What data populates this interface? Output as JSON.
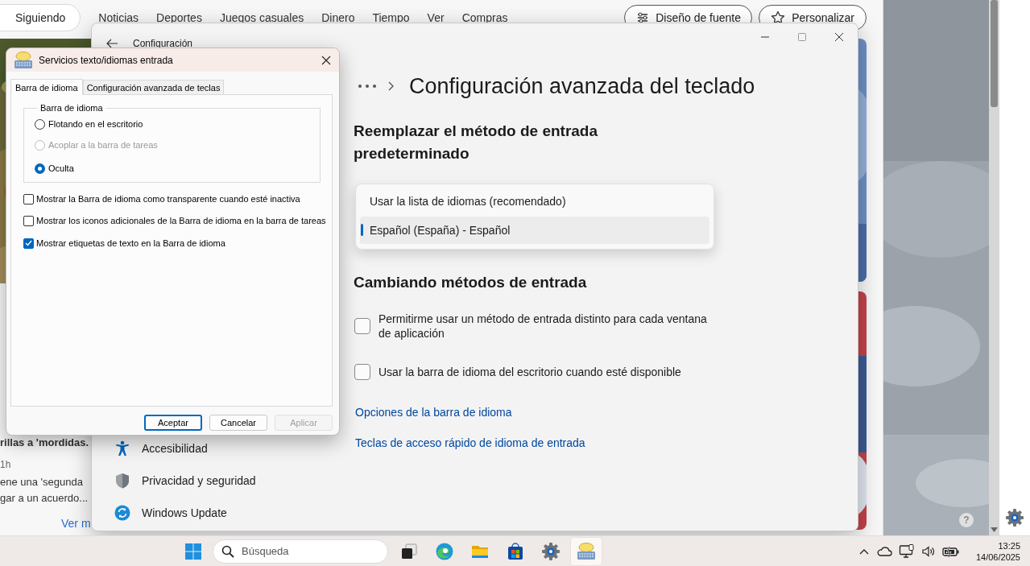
{
  "browser": {
    "following_tab": "Siguiendo",
    "nav_links": [
      "Noticias",
      "Deportes",
      "Juegos casuales",
      "Dinero",
      "Tiempo",
      "Ver",
      "Compras"
    ],
    "toolbar_buttons": [
      {
        "label": "Diseño de fuente",
        "kind": "sliders"
      },
      {
        "label": "Personalizar",
        "kind": "star"
      }
    ],
    "story": {
      "title_end": "rillas a 'mordidas.",
      "age": "1h",
      "snippet": "ene una 'segunda\ngar a un acuerdo...",
      "more_link": "Ver m"
    }
  },
  "settings": {
    "title": "Configuración",
    "heading": "Configuración avanzada del teclado",
    "nav_items": [
      {
        "label": "Accesibilidad",
        "kind": "accessibility"
      },
      {
        "label": "Privacidad y seguridad",
        "kind": "shield"
      },
      {
        "label": "Windows Update",
        "kind": "update"
      }
    ],
    "replace_heading": "Reemplazar el método de entrada predeterminado",
    "dropdown_options": [
      {
        "label": "Usar la lista de idiomas (recomendado)",
        "selected": false
      },
      {
        "label": "Español (España) - Español",
        "selected": true
      }
    ],
    "switch_heading": "Cambiando métodos de entrada",
    "checkboxes": [
      {
        "label": "Permitirme usar un método de entrada distinto para cada ventana de aplicación",
        "checked": false
      },
      {
        "label": "Usar la barra de idioma del escritorio cuando esté disponible",
        "checked": false
      }
    ],
    "links": [
      "Opciones de la barra de idioma",
      "Teclas de acceso rápido de idioma de entrada"
    ]
  },
  "dialog": {
    "title": "Servicios texto/idiomas entrada",
    "tabs": [
      {
        "label": "Barra de idioma",
        "selected": true
      },
      {
        "label": "Configuración avanzada de teclas",
        "selected": false
      }
    ],
    "group": {
      "legend": "Barra de idioma",
      "radios": [
        {
          "label": "Flotando en el escritorio",
          "selected": false,
          "disabled": false
        },
        {
          "label": "Acoplar a la barra de tareas",
          "selected": false,
          "disabled": true
        },
        {
          "label": "Oculta",
          "selected": true,
          "disabled": false
        }
      ]
    },
    "checkboxes": [
      {
        "label": "Mostrar la Barra de idioma como transparente cuando esté inactiva",
        "checked": false
      },
      {
        "label": "Mostrar los iconos adicionales de la Barra de idioma en la barra de tareas",
        "checked": false
      },
      {
        "label": "Mostrar etiquetas de texto en la Barra de idioma",
        "checked": true
      }
    ],
    "buttons": [
      {
        "label": "Aceptar",
        "default": true,
        "disabled": false
      },
      {
        "label": "Cancelar",
        "default": false,
        "disabled": false
      },
      {
        "label": "Aplicar",
        "default": false,
        "disabled": true
      }
    ]
  },
  "desktop": {
    "help_glyph": "?"
  },
  "taskbar": {
    "search_placeholder": "Búsqueda",
    "apps": [
      {
        "kind": "taskview",
        "active": false
      },
      {
        "kind": "edge",
        "active": false
      },
      {
        "kind": "explorer",
        "active": false
      },
      {
        "kind": "store",
        "active": false
      },
      {
        "kind": "settings",
        "active": false
      },
      {
        "kind": "language",
        "active": true
      }
    ],
    "tray": [
      {
        "kind": "chevron"
      },
      {
        "kind": "cloud"
      },
      {
        "kind": "monitor"
      },
      {
        "kind": "speaker"
      },
      {
        "kind": "battery"
      }
    ],
    "time": "13:25",
    "date": "14/06/2025"
  }
}
